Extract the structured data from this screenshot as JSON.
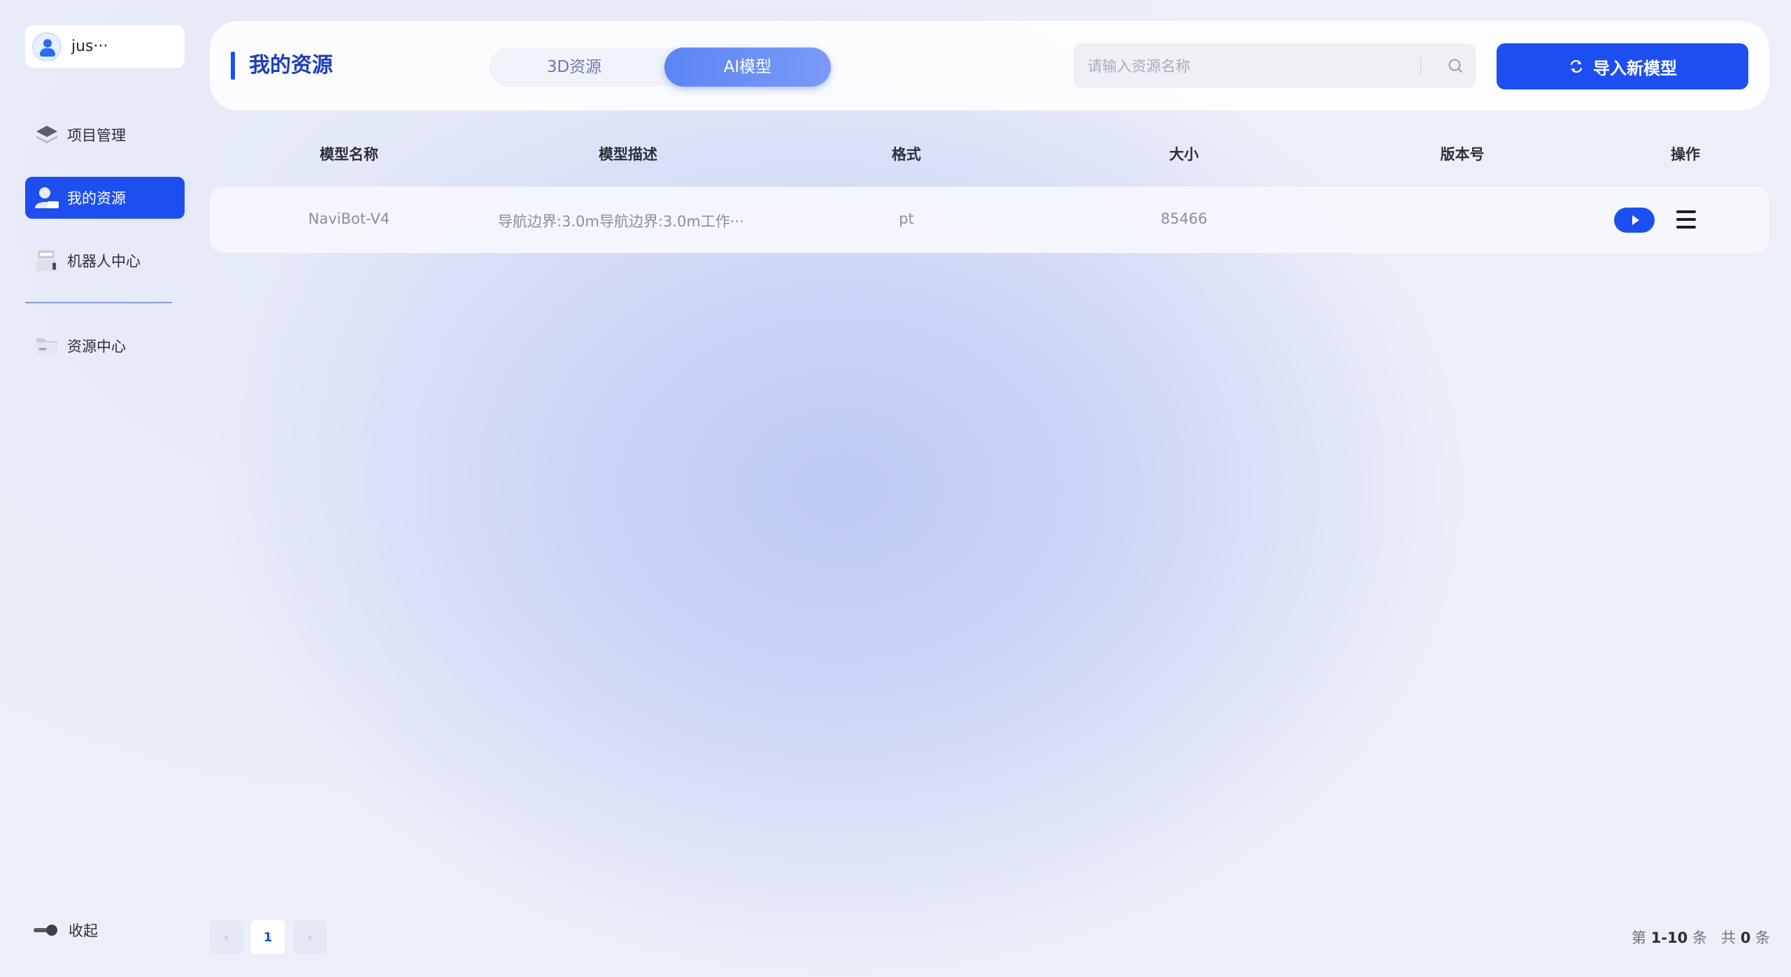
{
  "user": {
    "name": "jus···"
  },
  "sidebar": {
    "items": [
      {
        "label": "项目管理",
        "icon": "layers-icon",
        "active": false
      },
      {
        "label": "我的资源",
        "icon": "user-resource-icon",
        "active": true
      },
      {
        "label": "机器人中心",
        "icon": "robot-icon",
        "active": false
      },
      {
        "label": "资源中心",
        "icon": "folder-icon",
        "active": false
      }
    ],
    "collapse_label": "收起"
  },
  "header": {
    "title": "我的资源",
    "tabs": [
      {
        "label": "3D资源",
        "active": false
      },
      {
        "label": "AI模型",
        "active": true
      }
    ],
    "search_placeholder": "请输入资源名称",
    "import_label": "导入新模型"
  },
  "table": {
    "columns": [
      "模型名称",
      "模型描述",
      "格式",
      "大小",
      "版本号",
      "操作"
    ],
    "rows": [
      {
        "name": "NaviBot-V4",
        "description": "导航边界:3.0m导航边界:3.0m工作···",
        "format": "pt",
        "size": "85466",
        "version": ""
      }
    ]
  },
  "pagination": {
    "prev": "‹",
    "current": "1",
    "next": "›",
    "range_prefix": "第",
    "range": "1-10",
    "range_suffix": "条",
    "total_prefix": "共",
    "total": "0",
    "total_suffix": "条"
  },
  "colors": {
    "accent": "#1d4ff0",
    "title": "#1d3fb8",
    "tab_active": "#6a8ff5"
  }
}
